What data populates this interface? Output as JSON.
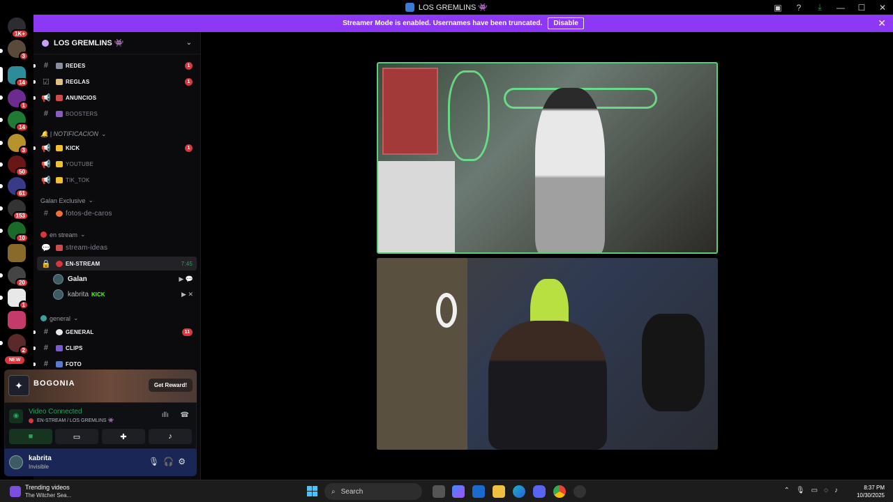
{
  "window": {
    "title": "LOS GREMLINS 👾",
    "controls": [
      "—",
      "☐",
      "✕"
    ]
  },
  "banner": {
    "text": "Streamer Mode is enabled. Usernames have been truncated.",
    "button": "Disable"
  },
  "rail": {
    "badges": [
      "1K+",
      "3",
      "14",
      "1",
      "14",
      "3",
      "50",
      "61",
      "153",
      "10",
      "20",
      "1",
      "2",
      "NEW"
    ]
  },
  "guild": {
    "name": "LOS GREMLINS 👾"
  },
  "channels": [
    {
      "name": "REDES",
      "badge": "1"
    },
    {
      "name": "REGLAS",
      "badge": "1"
    },
    {
      "name": "ANUNCIOS",
      "badge": ""
    },
    {
      "name": "BOOSTERS",
      "badge": ""
    }
  ],
  "categories": {
    "notificacion": "🔔 | NOTIFICACION",
    "galan": "Galan Exclusive",
    "en_stream": "en stream",
    "general": "general"
  },
  "notif_channels": [
    {
      "name": "KICK",
      "badge": "1"
    },
    {
      "name": "YOUTUBE",
      "badge": ""
    },
    {
      "name": "TIK_TOK",
      "badge": ""
    }
  ],
  "galan_channels": [
    {
      "name": "fotos-de-caros"
    }
  ],
  "stream_channels": [
    {
      "name": "stream-ideas"
    },
    {
      "name": "EN-STREAM",
      "timer": "7:45"
    }
  ],
  "voice_users": [
    {
      "name": "Galan"
    },
    {
      "name": "kabrita",
      "tag": "KICK"
    }
  ],
  "general_channels": [
    {
      "name": "GENERAL",
      "badge": "11"
    },
    {
      "name": "CLIPS",
      "badge": ""
    },
    {
      "name": "FOTO",
      "badge": ""
    }
  ],
  "promo": {
    "title": "BOGONIA",
    "button": "Get Reward!"
  },
  "voice": {
    "status": "Video Connected",
    "location": "EN-STREAM / LOS GREMLINS 👾"
  },
  "user": {
    "name": "kabrita",
    "status": "Invisible"
  },
  "taskbar": {
    "trend_title": "Trending videos",
    "trend_sub": "The Witcher Sea...",
    "search_placeholder": "Search",
    "time": "8:37 PM",
    "date": "10/30/2025"
  },
  "colors": {
    "accent": "#8c38f5",
    "badge": "#da373c",
    "voice_green": "#23a55a",
    "tile_border": "#58d07a"
  }
}
